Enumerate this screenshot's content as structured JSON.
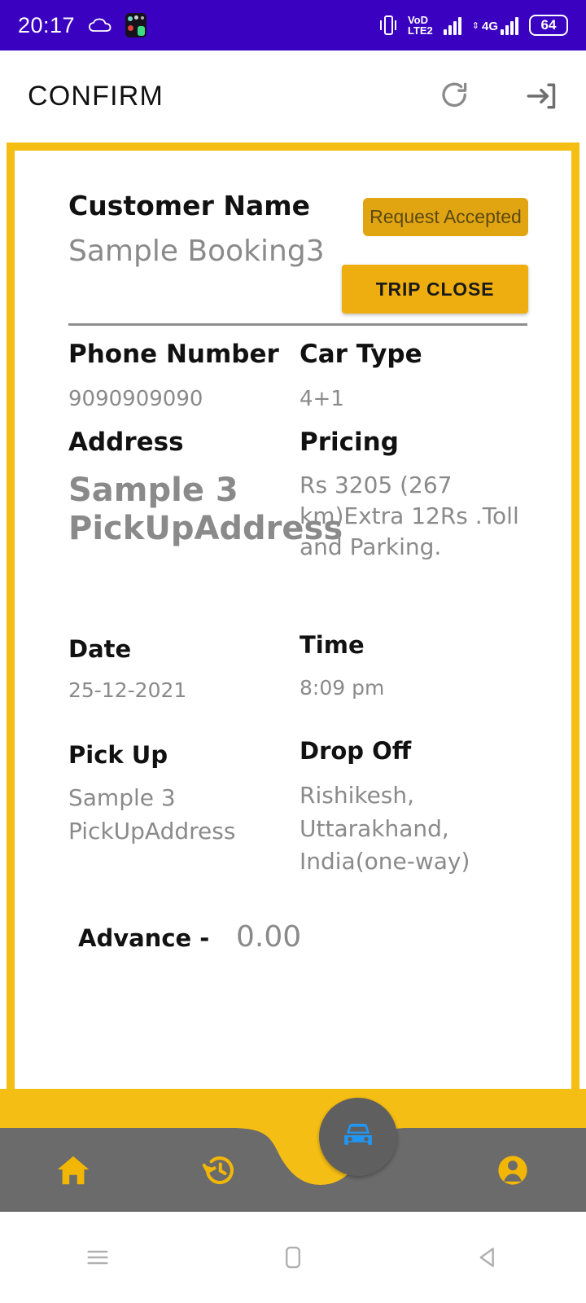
{
  "status_bar": {
    "clock": "20:17",
    "icons": [
      "cloud-icon",
      "app-notification-icon",
      "vibrate-icon",
      "volte-icon",
      "signal-bars-icon",
      "4g-signal-icon"
    ],
    "volte_line1": "VoD",
    "volte_line2": "LTE2",
    "network_4g": "4G",
    "battery_level": "64",
    "background_color": "#3A02C0"
  },
  "appbar": {
    "title": "CONFIRM",
    "refresh_label": "refresh",
    "logout_label": "logout"
  },
  "booking": {
    "customer_name_label": "Customer Name",
    "customer_name_value": "Sample Booking3",
    "status_badge": "Request Accepted",
    "trip_close_button": "TRIP CLOSE",
    "phone_label": "Phone Number",
    "phone_value": "9090909090",
    "car_type_label": "Car Type",
    "car_type_value": "4+1",
    "address_label": "Address",
    "address_value": "Sample 3 PickUpAddress",
    "pricing_label": "Pricing",
    "pricing_value": "Rs 3205 (267 km)Extra 12Rs .Toll and Parking.",
    "date_label": "Date",
    "date_value": "25-12-2021",
    "time_label": "Time",
    "time_value": "8:09 pm",
    "pickup_label": "Pick Up",
    "pickup_value": "Sample 3 PickUpAddress",
    "dropoff_label": "Drop Off",
    "dropoff_value": "Rishikesh, Uttarakhand, India(one-way)",
    "advance_label": "Advance -",
    "advance_value": "0.00"
  },
  "bottom_nav": {
    "items": [
      {
        "name": "home",
        "icon": "home-icon"
      },
      {
        "name": "history",
        "icon": "history-clock-icon"
      },
      {
        "name": "trips",
        "icon": "car-icon"
      },
      {
        "name": "profile",
        "icon": "person-icon"
      }
    ]
  },
  "system_nav": {
    "recents": "recents-icon",
    "home": "home-square-icon",
    "back": "back-triangle-icon"
  },
  "colors": {
    "frame_yellow": "#F5BE14",
    "badge_amber": "#E2A512",
    "button_amber": "#EFAE10",
    "nav_gray": "#6B6B6B",
    "fab_gray": "#5F5F5F",
    "car_blue": "#2196F3",
    "status_purple": "#3A02C0",
    "label_black": "#111111",
    "value_gray": "#8A8A8A"
  }
}
